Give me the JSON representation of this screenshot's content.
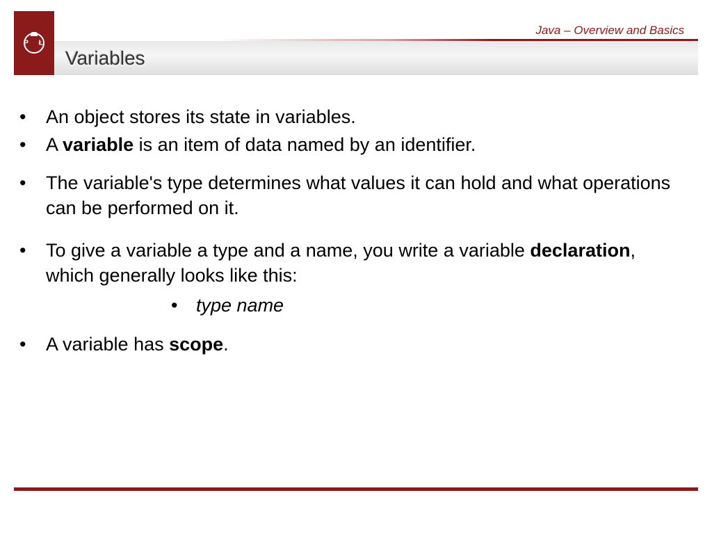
{
  "header": {
    "subtitle": "Java – Overview and Basics",
    "title": "Variables",
    "logo_letters": "P Ł"
  },
  "bullets": {
    "b1": "An object stores its state in variables.",
    "b2_pre": "A ",
    "b2_bold": "variable",
    "b2_post": " is an item of data named by an identifier.",
    "b3": "The variable's type determines what values it can hold and what operations can be performed on it.",
    "b4_pre": "To give a variable a type and a name, you write a variable ",
    "b4_bold": "declaration",
    "b4_post": ", which generally looks like this:",
    "sub": "type name",
    "b5_pre": "A variable has ",
    "b5_bold": "scope",
    "b5_post": "."
  }
}
